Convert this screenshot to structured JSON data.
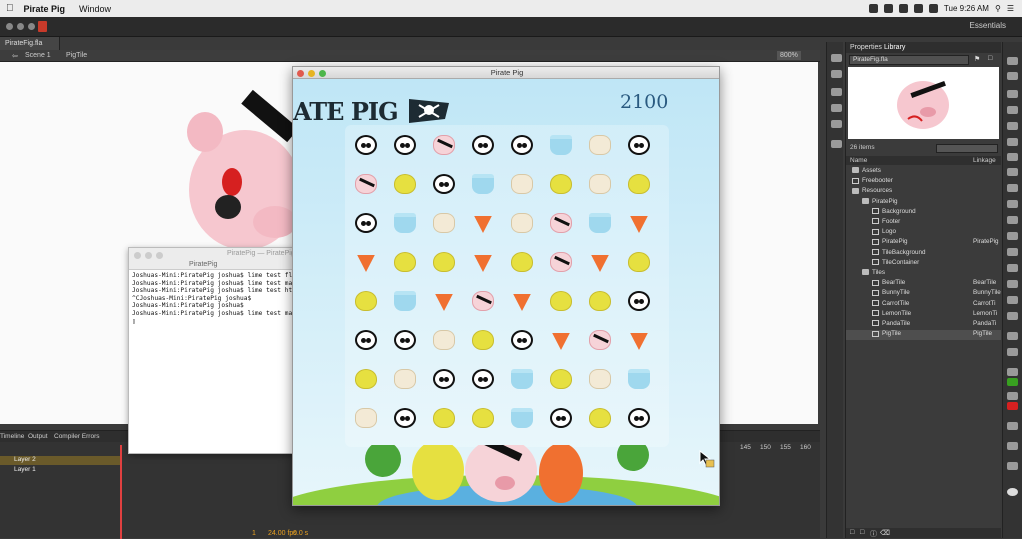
{
  "menubar": {
    "app_name": "Pirate Pig",
    "menus": [
      "Window"
    ],
    "clock": "Tue 9:26 AM"
  },
  "app_toolbar": {
    "workspace": "Essentials"
  },
  "document": {
    "tab": "PirateFig.fla",
    "scene": "Scene 1",
    "symbol": "PigTile",
    "zoom": "800%"
  },
  "timeline": {
    "tabs": [
      "Timeline",
      "Output",
      "Compiler Errors"
    ],
    "layers": [
      "Layer 2",
      "Layer 1"
    ],
    "frame_numbers": [
      "145",
      "150",
      "155",
      "160"
    ],
    "fps": "24.00 fps",
    "time": "0.0 s",
    "frame": "1"
  },
  "right_panel": {
    "tabs": [
      "Properties",
      "Library"
    ],
    "library_file": "PirateFig.fla",
    "item_count": "26 items",
    "columns": [
      "Name",
      "Linkage"
    ],
    "items": [
      {
        "indent": 0,
        "type": "folder",
        "name": "Assets",
        "linkage": ""
      },
      {
        "indent": 0,
        "type": "font",
        "name": "Freebooter",
        "linkage": ""
      },
      {
        "indent": 0,
        "type": "folder",
        "name": "Resources",
        "linkage": ""
      },
      {
        "indent": 1,
        "type": "folder",
        "name": "PiratePig",
        "linkage": ""
      },
      {
        "indent": 2,
        "type": "clip",
        "name": "Background",
        "linkage": ""
      },
      {
        "indent": 2,
        "type": "clip",
        "name": "Footer",
        "linkage": ""
      },
      {
        "indent": 2,
        "type": "clip",
        "name": "Logo",
        "linkage": ""
      },
      {
        "indent": 2,
        "type": "clip",
        "name": "PiratePig",
        "linkage": "PiratePig"
      },
      {
        "indent": 2,
        "type": "clip",
        "name": "TileBackground",
        "linkage": ""
      },
      {
        "indent": 2,
        "type": "clip",
        "name": "TileContainer",
        "linkage": ""
      },
      {
        "indent": 1,
        "type": "folder",
        "name": "Tiles",
        "linkage": ""
      },
      {
        "indent": 2,
        "type": "clip",
        "name": "BearTile",
        "linkage": "BearTile"
      },
      {
        "indent": 2,
        "type": "clip",
        "name": "BunnyTile",
        "linkage": "BunnyTile"
      },
      {
        "indent": 2,
        "type": "clip",
        "name": "CarrotTile",
        "linkage": "CarrotTi"
      },
      {
        "indent": 2,
        "type": "clip",
        "name": "LemonTile",
        "linkage": "LemonTi"
      },
      {
        "indent": 2,
        "type": "clip",
        "name": "PandaTile",
        "linkage": "PandaTi"
      },
      {
        "indent": 2,
        "type": "clip",
        "name": "PigTile",
        "linkage": "PigTile",
        "selected": true
      }
    ]
  },
  "terminal": {
    "title": "PiratePig — PiratePig",
    "subtitle": "PiratePig",
    "lines": [
      "Joshuas-Mini:PiratePig joshua$ lime test fl",
      "Joshuas-Mini:PiratePig joshua$ lime test ma",
      "Joshuas-Mini:PiratePig joshua$ lime test ht",
      "^CJoshuas-Mini:PiratePig joshua$",
      "Joshuas-Mini:PiratePig joshua$",
      "Joshuas-Mini:PiratePig joshua$ lime test ma",
      "▯"
    ]
  },
  "game": {
    "window_title": "Pirate Pig",
    "logo_text": "ATE PIG",
    "score": "2100",
    "tiles": [
      [
        "panda",
        "panda",
        "pig",
        "panda",
        "panda",
        "bunny",
        "bear",
        "panda"
      ],
      [
        "pig",
        "lemon",
        "panda",
        "bunny",
        "bear",
        "lemon",
        "bear",
        "lemon"
      ],
      [
        "panda",
        "bunny",
        "bear",
        "carrot",
        "bear",
        "pig",
        "bunny",
        "carrot"
      ],
      [
        "carrot",
        "lemon",
        "lemon",
        "carrot",
        "lemon",
        "pig",
        "carrot",
        "lemon"
      ],
      [
        "lemon",
        "bunny",
        "carrot",
        "pig",
        "carrot",
        "lemon",
        "lemon",
        "panda"
      ],
      [
        "panda",
        "panda",
        "bear",
        "lemon",
        "panda",
        "carrot",
        "pig",
        "carrot"
      ],
      [
        "lemon",
        "bear",
        "panda",
        "panda",
        "bunny",
        "lemon",
        "bear",
        "bunny"
      ],
      [
        "bear",
        "panda",
        "lemon",
        "lemon",
        "bunny",
        "panda",
        "lemon",
        "panda"
      ]
    ]
  },
  "colors": {
    "accent": "#f0c020",
    "selection_layer": "#5a4a2a",
    "playhead": "#e04040"
  }
}
